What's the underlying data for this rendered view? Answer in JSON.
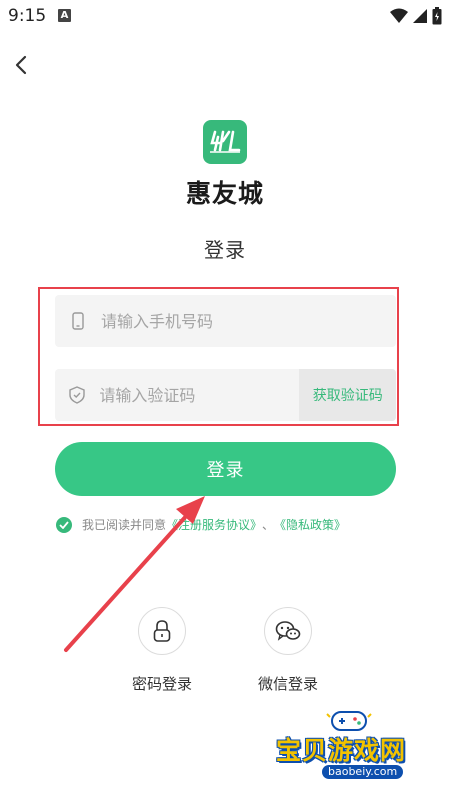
{
  "status_bar": {
    "time": "9:15",
    "notification_letter": "A"
  },
  "app": {
    "name": "惠友城",
    "logo_glyph": "hyc"
  },
  "page_title": "登录",
  "form": {
    "phone_placeholder": "请输入手机号码",
    "code_placeholder": "请输入验证码",
    "get_code_label": "获取验证码",
    "login_label": "登录"
  },
  "agreement": {
    "prefix": "我已阅读并同意",
    "service_link": "《注册服务协议》",
    "separator": "、",
    "privacy_link": "《隐私政策》",
    "checked": true
  },
  "alt_login": [
    {
      "label": "密码登录",
      "icon": "lock-icon"
    },
    {
      "label": "微信登录",
      "icon": "wechat-icon"
    }
  ],
  "watermark": {
    "title": "宝贝游戏网",
    "url": "baobeiy.com"
  },
  "colors": {
    "accent": "#37b97b",
    "button": "#37c786",
    "highlight": "#e8414b",
    "arrow": "#e8414b"
  }
}
